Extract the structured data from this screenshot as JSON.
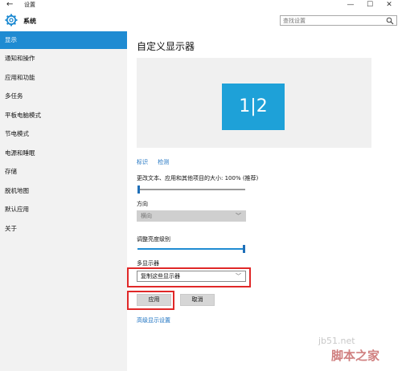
{
  "window": {
    "back_glyph": "←",
    "title": "设置",
    "controls": {
      "minimize": "—",
      "maximize": "☐",
      "close": "✕"
    }
  },
  "header": {
    "app_title": "系统",
    "search_placeholder": "查找设置"
  },
  "sidebar": {
    "items": [
      {
        "label": "显示",
        "active": true
      },
      {
        "label": "通知和操作"
      },
      {
        "label": "应用和功能"
      },
      {
        "label": "多任务"
      },
      {
        "label": "平板电脑模式"
      },
      {
        "label": "节电模式"
      },
      {
        "label": "电源和睡眠"
      },
      {
        "label": "存储"
      },
      {
        "label": "脱机地图"
      },
      {
        "label": "默认应用"
      },
      {
        "label": "关于"
      }
    ]
  },
  "main": {
    "title": "自定义显示器",
    "monitor_label": "1|2",
    "identify_link": "标识",
    "detect_link": "检测",
    "scale_label": "更改文本、应用和其他项目的大小: 100% (推荐)",
    "scale_level": 0,
    "orientation_label": "方向",
    "orientation_value": "横向",
    "brightness_label": "调整亮度级别",
    "brightness_level": 1,
    "multi_display_label": "多显示器",
    "multi_display_value": "复制这些显示器",
    "apply_button": "应用",
    "cancel_button": "取消",
    "advanced_link": "高级显示设置"
  },
  "watermark": {
    "site": "jb51.net",
    "brand": "脚本之家"
  },
  "colors": {
    "accent": "#1f8bd2",
    "monitor": "#1ea1d8",
    "highlight_box": "#e02828",
    "link": "#1a70c0"
  }
}
